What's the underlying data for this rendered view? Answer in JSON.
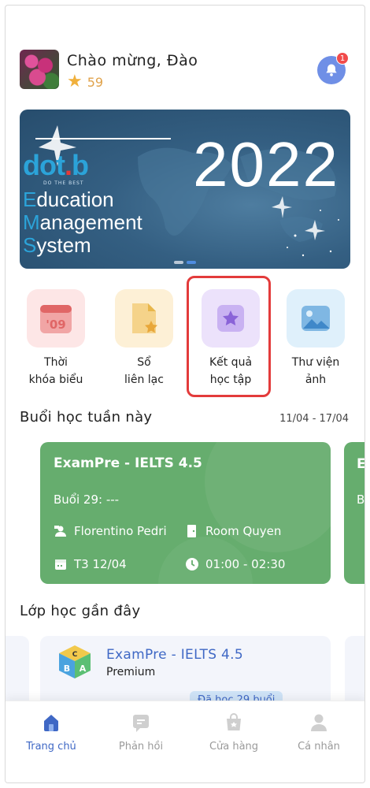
{
  "header": {
    "greeting": "Chào mừng, Đào",
    "points": "59",
    "notification_count": "1"
  },
  "banner": {
    "year": "2022",
    "logo_prefix": "dot",
    "logo_dot": ".",
    "logo_suffix": "b",
    "tagline": "DO THE BEST",
    "line1_cap": "E",
    "line1_rest": "ducation",
    "line2_cap": "M",
    "line2_rest": "anagement",
    "line3_cap": "S",
    "line3_rest": "ystem",
    "carousel_pages": 2,
    "carousel_active": 2
  },
  "quick_menu": [
    {
      "label": "Thời\nkhóa biểu",
      "icon_text": "'09",
      "bg": "#fde6e6",
      "accent": "#e06666"
    },
    {
      "label": "Sổ\nliên lạc",
      "bg": "#fdf0d6",
      "accent": "#e8b64b"
    },
    {
      "label": "Kết quả\nhọc tập",
      "bg": "#ece2fb",
      "accent": "#9a74e0"
    },
    {
      "label": "Thư viện\nảnh",
      "bg": "#dff0fb",
      "accent": "#5a9fd6"
    }
  ],
  "week": {
    "title": "Buổi học tuần này",
    "range": "11/04 - 17/04",
    "card": {
      "title": "ExamPre - IELTS 4.5",
      "session": "Buổi 29: ---",
      "teacher": "Florentino Pedri",
      "room": "Room Quyen",
      "date": "T3 12/04",
      "time": "01:00 - 02:30"
    },
    "peek_title": "E",
    "peek_session": "B"
  },
  "recent": {
    "title": "Lớp học gần đây",
    "card": {
      "title": "ExamPre - IELTS 4.5",
      "subtitle": "Premium",
      "status": "Đã học 29 buổi"
    }
  },
  "nav": [
    {
      "label": "Trang chủ",
      "icon": "home-icon",
      "active": true
    },
    {
      "label": "Phản hồi",
      "icon": "feedback-icon",
      "active": false
    },
    {
      "label": "Cửa hàng",
      "icon": "shop-icon",
      "active": false
    },
    {
      "label": "Cá nhân",
      "icon": "profile-icon",
      "active": false
    }
  ],
  "colors": {
    "primary": "#3f68c5",
    "card_green": "#66ad6e",
    "highlight_red": "#e33b3b",
    "banner_blue": "#345f82"
  }
}
